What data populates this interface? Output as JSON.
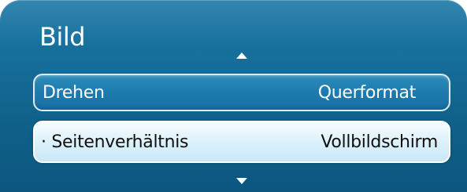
{
  "menu": {
    "title": "Bild",
    "items": [
      {
        "label": "Drehen",
        "value": "Querformat"
      },
      {
        "label": "· Seitenverhältnis",
        "value": "Vollbildschirm"
      }
    ],
    "icons": {
      "scroll_up": "triangle-up-icon",
      "scroll_down": "triangle-down-icon"
    },
    "colors": {
      "panel": "#156c98",
      "selected_row": "#dff2fb",
      "text_on_panel": "#ffffff",
      "text_on_selected": "#111111"
    }
  }
}
